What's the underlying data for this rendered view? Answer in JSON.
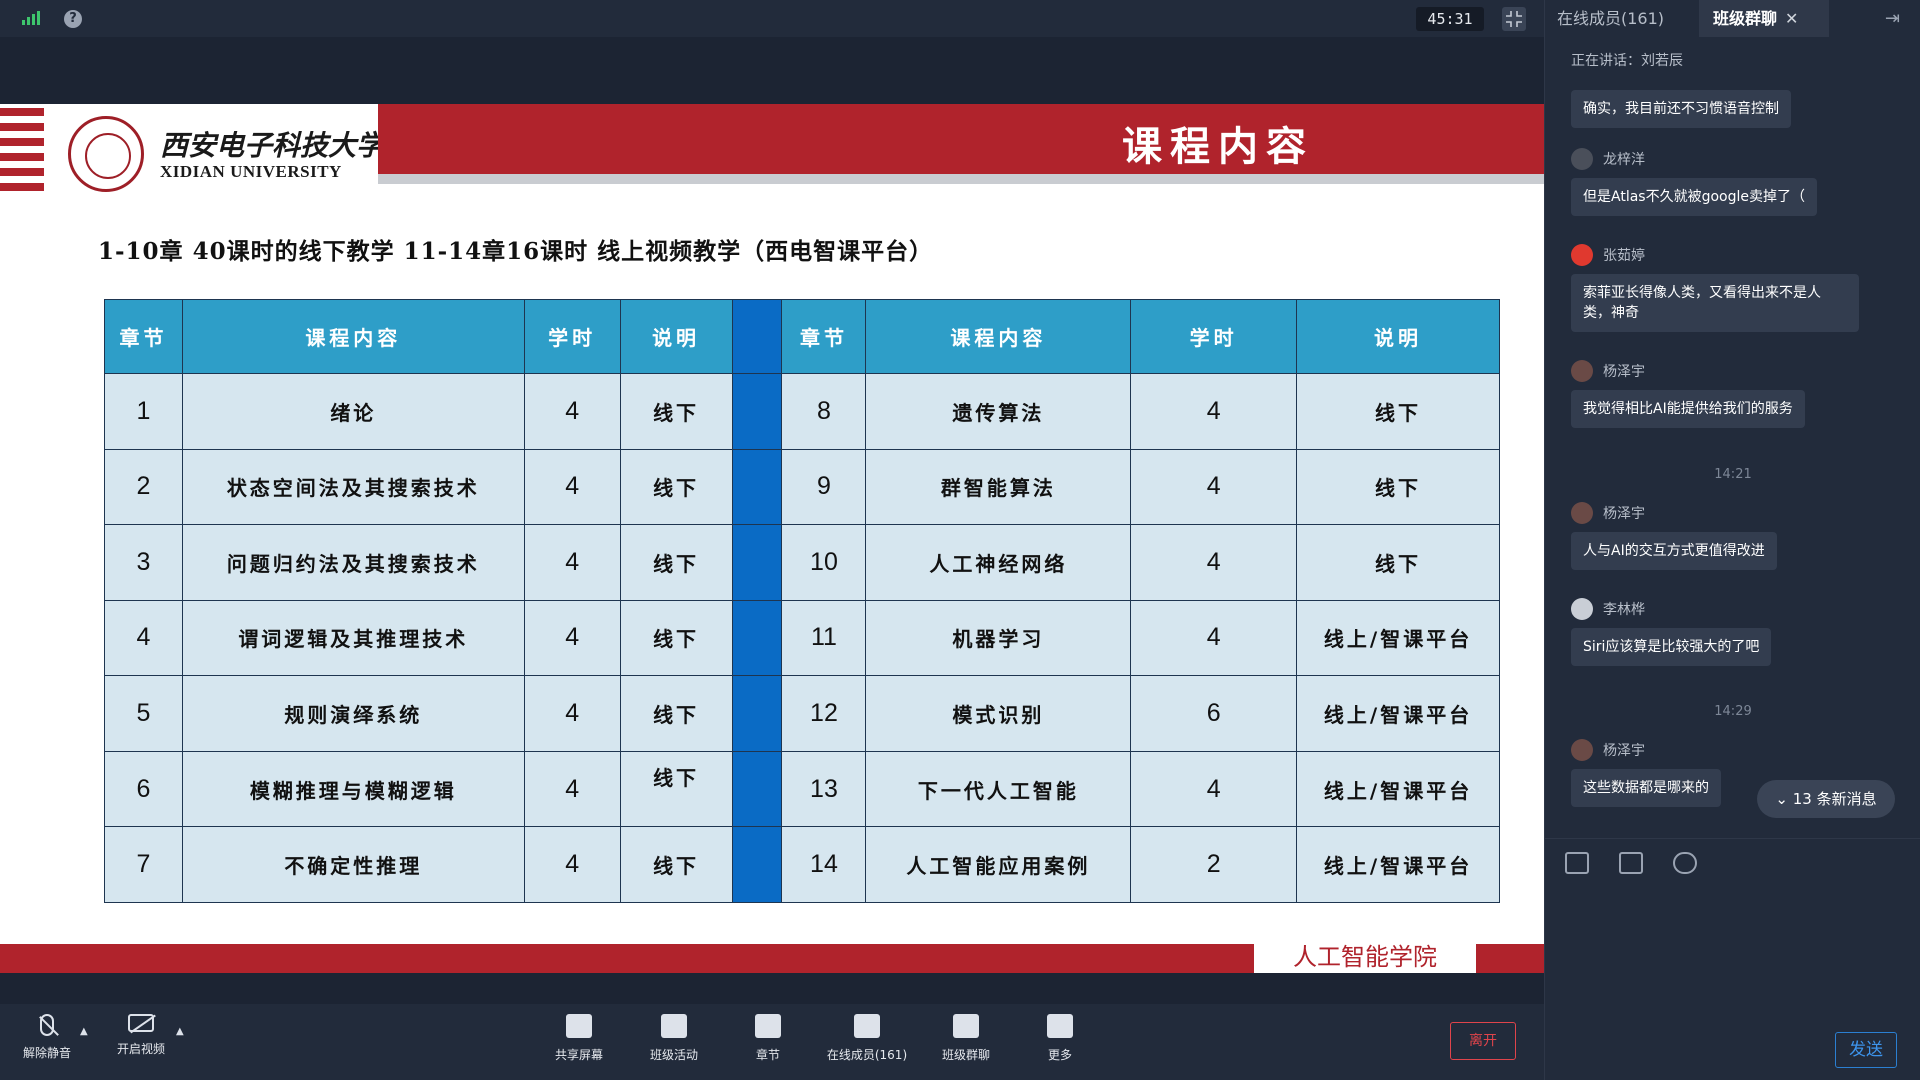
{
  "topbar": {
    "timer": "45:31"
  },
  "slide": {
    "university_cn": "西安电子科技大学",
    "university_en": "XIDIAN UNIVERSITY",
    "title": "课程内容",
    "subtitle": "1-10章 40课时的线下教学 11-14章16课时 线上视频教学（西电智课平台）",
    "table": {
      "headers": [
        "章节",
        "课程内容",
        "学时",
        "说明",
        "章节",
        "课程内容",
        "学时",
        "说明"
      ],
      "rows": [
        [
          "1",
          "绪论",
          "4",
          "线下",
          "8",
          "遗传算法",
          "4",
          "线下"
        ],
        [
          "2",
          "状态空间法及其搜索技术",
          "4",
          "线下",
          "9",
          "群智能算法",
          "4",
          "线下"
        ],
        [
          "3",
          "问题归约法及其搜索技术",
          "4",
          "线下",
          "10",
          "人工神经网络",
          "4",
          "线下"
        ],
        [
          "4",
          "谓词逻辑及其推理技术",
          "4",
          "线下",
          "11",
          "机器学习",
          "4",
          "线上/智课平台"
        ],
        [
          "5",
          "规则演绎系统",
          "4",
          "线下",
          "12",
          "模式识别",
          "6",
          "线上/智课平台"
        ],
        [
          "6",
          "模糊推理与模糊逻辑",
          "4",
          "线下",
          "13",
          "下一代人工智能",
          "4",
          "线上/智课平台"
        ],
        [
          "7",
          "不确定性推理",
          "4",
          "线下",
          "14",
          "人工智能应用案例",
          "2",
          "线上/智课平台"
        ]
      ]
    },
    "footer": "人工智能学院"
  },
  "toolbar": {
    "unmute": "解除静音",
    "video": "开启视频",
    "share": "共享屏幕",
    "activity": "班级活动",
    "chapter": "章节",
    "members": "在线成员(161)",
    "chat": "班级群聊",
    "more": "更多",
    "leave": "离开"
  },
  "panel": {
    "tab_members": "在线成员(161)",
    "tab_chat": "班级群聊",
    "speaking": "正在讲话：刘若辰",
    "messages": [
      {
        "text": "确实，我目前还不习惯语音控制"
      },
      {
        "name": "龙梓洋",
        "text": "但是Atlas不久就被google卖掉了（"
      },
      {
        "name": "张茹婷",
        "text": "索菲亚长得像人类，又看得出来不是人类，神奇"
      },
      {
        "name": "杨泽宇",
        "text": "我觉得相比AI能提供给我们的服务"
      },
      {
        "time": "14:21"
      },
      {
        "name": "杨泽宇",
        "text": "人与AI的交互方式更值得改进"
      },
      {
        "name": "李林桦",
        "text": "Siri应该算是比较强大的了吧"
      },
      {
        "time": "14:29"
      },
      {
        "name": "杨泽宇",
        "text": "这些数据都是哪来的"
      }
    ],
    "new_messages": "13 条新消息",
    "send": "发送"
  },
  "colors": {
    "brand_red": "#b0232c",
    "table_header": "#2e9ec8",
    "table_cell": "#d6e6ef",
    "separator": "#0a6bc5"
  }
}
